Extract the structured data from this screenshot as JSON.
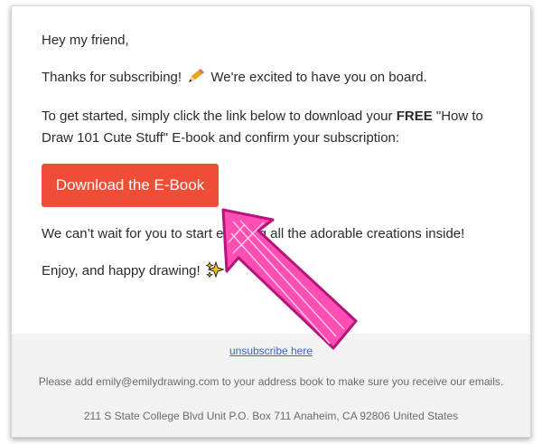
{
  "email": {
    "greeting": "Hey my friend,",
    "thanks_before": "Thanks for subscribing!",
    "thanks_after": "We're excited to have you on board.",
    "start_before": "To get started, simply click the link below to download your",
    "start_bold": "FREE",
    "start_after": "\"How to Draw 101 Cute Stuff\" E-book and confirm your subscription:",
    "cta_label": "Download the E-Book",
    "wait_text": "We can’t wait for you to start enjoying all the adorable creations inside!",
    "signoff": "Enjoy, and happy drawing!",
    "thanks_icon": "pencil-emoji",
    "signoff_icon": "sparkles-emoji"
  },
  "footer": {
    "unsubscribe_label": "unsubscribe here",
    "address_note": "Please add emily@emilydrawing.com to your address book to make sure you receive our emails.",
    "postal_address": "211 S State College Blvd Unit P.O. Box 711 Anaheim, CA 92806 United States"
  },
  "colors": {
    "cta_background": "#ee4d36",
    "annotation_arrow": "#ff4fb3",
    "link": "#3b64c4",
    "footer_background": "#f2f2f2"
  }
}
